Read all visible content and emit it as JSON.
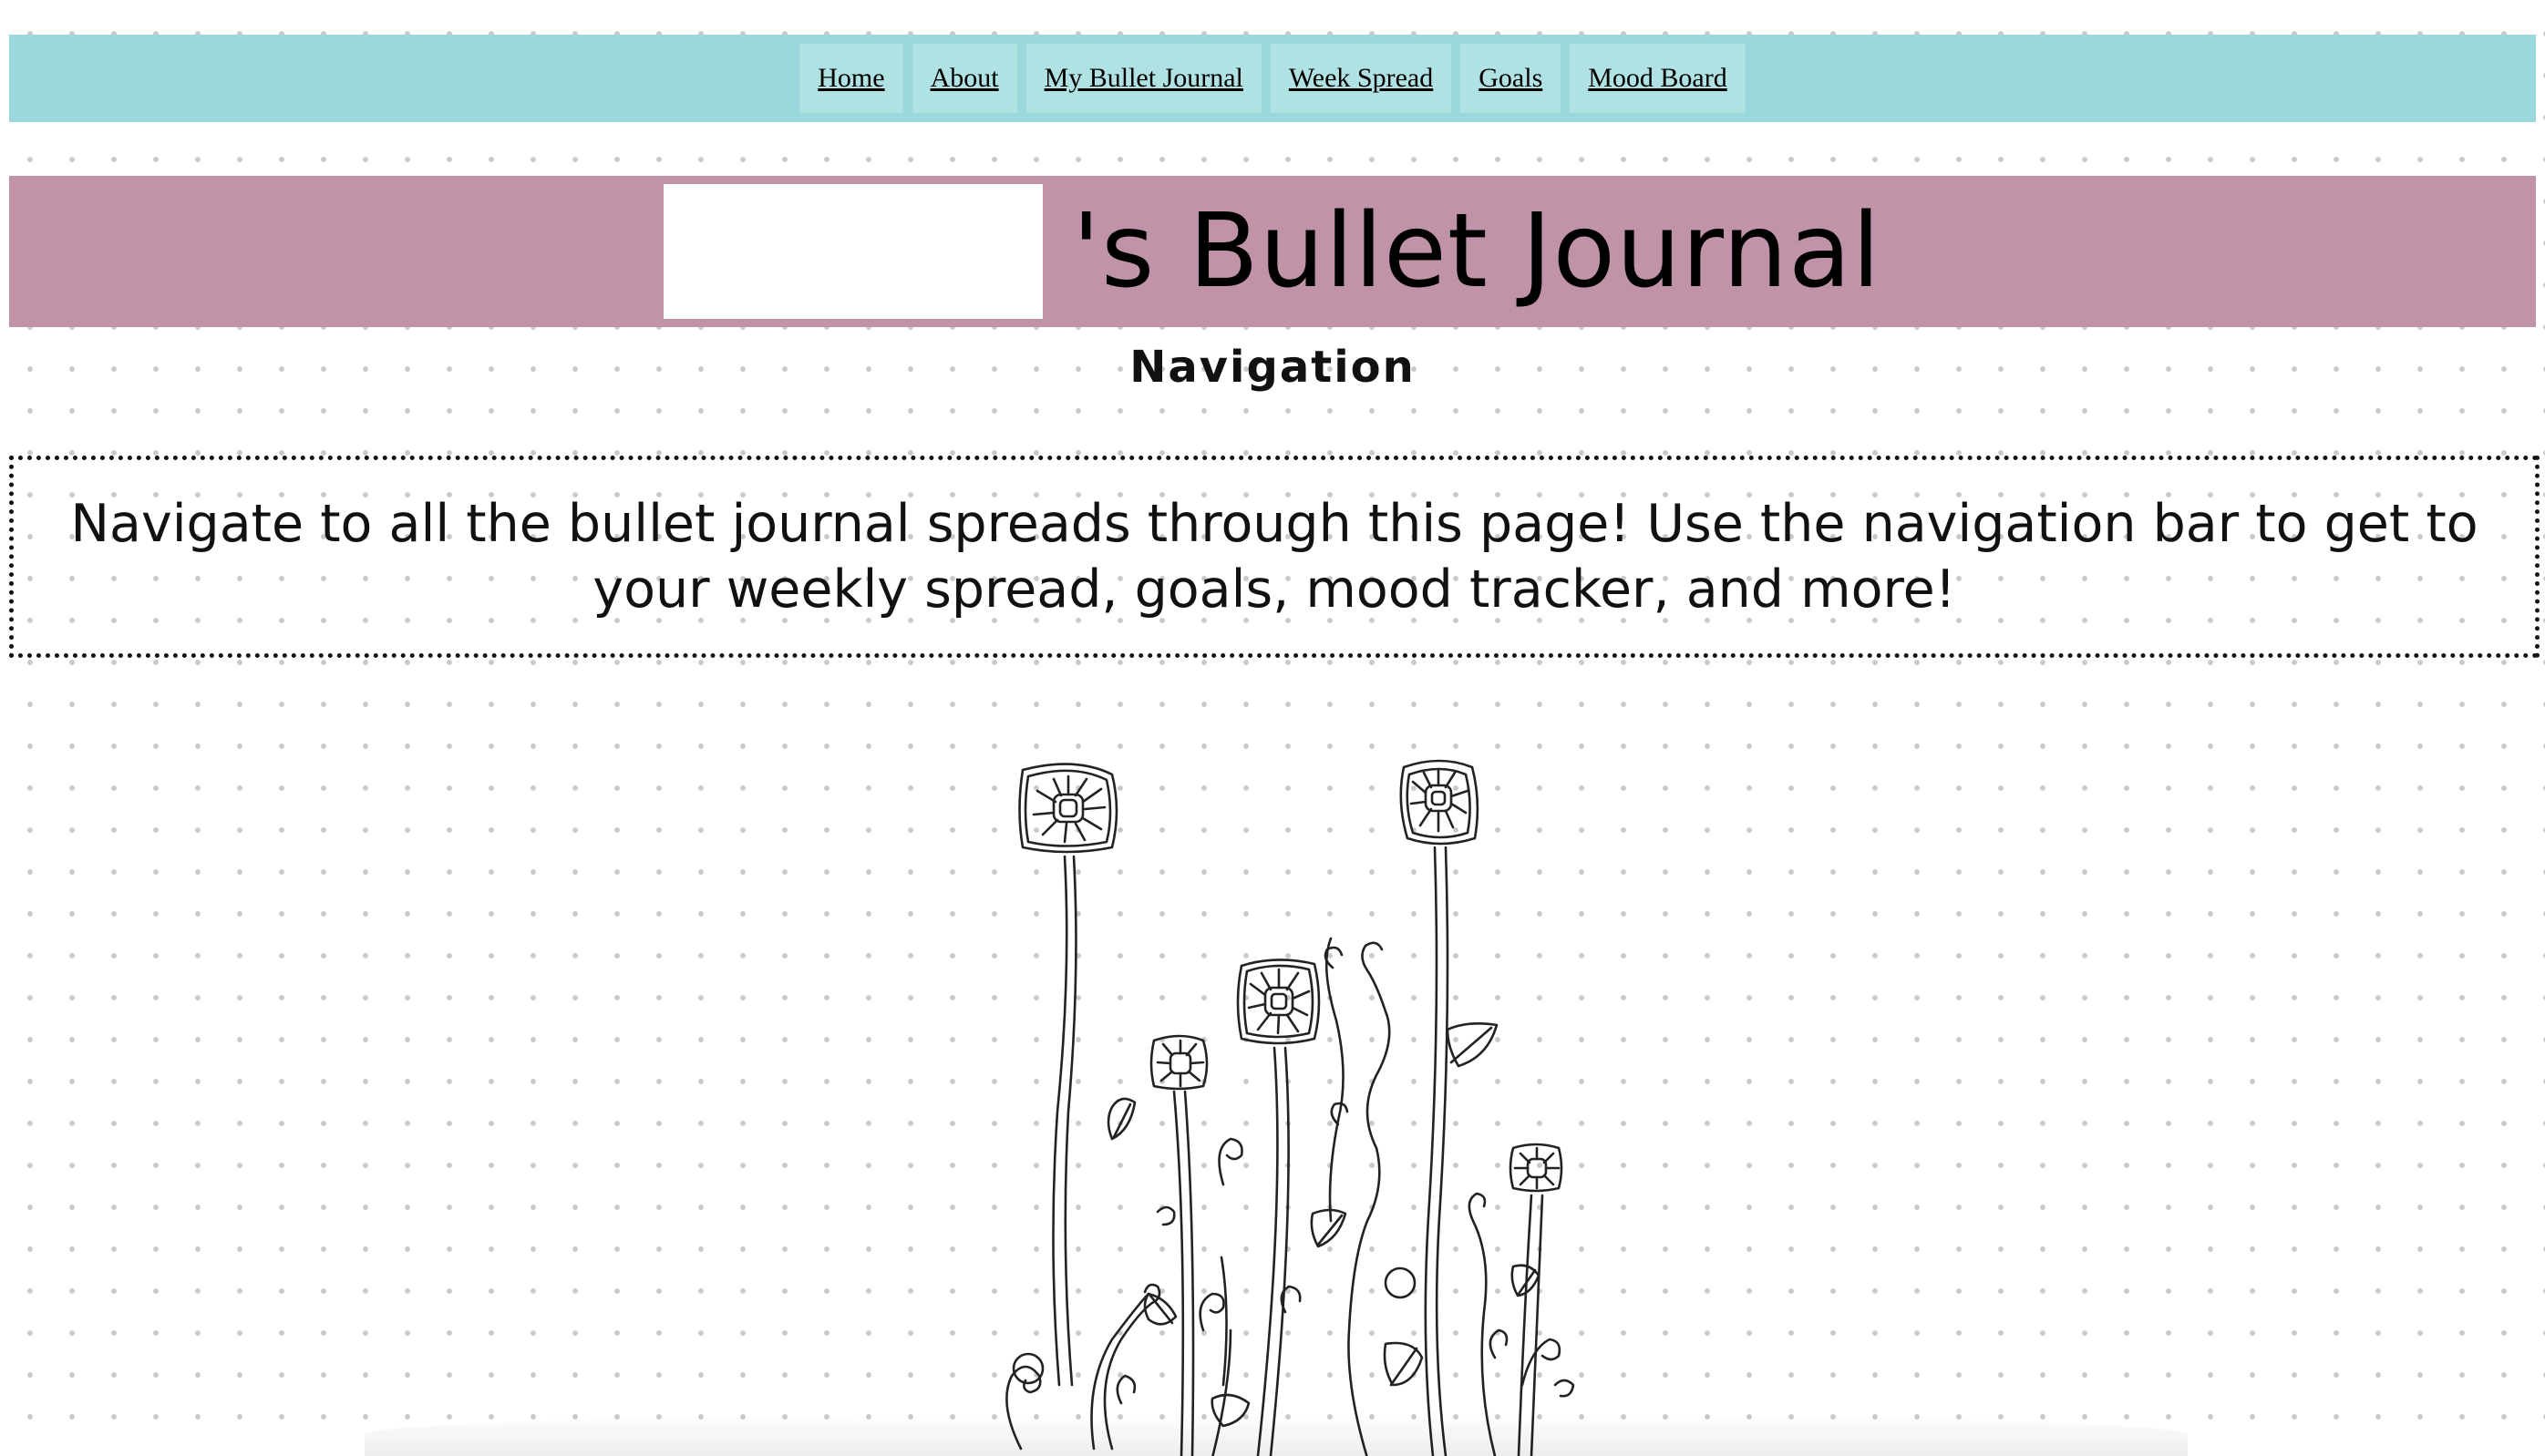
{
  "nav": {
    "links": [
      {
        "label": "Home"
      },
      {
        "label": "About"
      },
      {
        "label": "My Bullet Journal"
      },
      {
        "label": "Week Spread"
      },
      {
        "label": "Goals"
      },
      {
        "label": "Mood Board"
      }
    ]
  },
  "banner": {
    "name_placeholder": "",
    "title": "'s Bullet Journal"
  },
  "section": {
    "title": "Navigation"
  },
  "intro": {
    "text": "Navigate to all the bullet journal spreads through this page! Use the navigation bar to get to your weekly spread, goals, mood tracker, and more!"
  },
  "illustration": {
    "icon": "doodle-flowers-icon"
  },
  "colors": {
    "nav_bg": "#9bd8dc",
    "nav_item_bg": "#b0e2e4",
    "banner_bg": "#c093a9",
    "page_bg": "#ffffff",
    "dot": "#c9c9c9"
  }
}
